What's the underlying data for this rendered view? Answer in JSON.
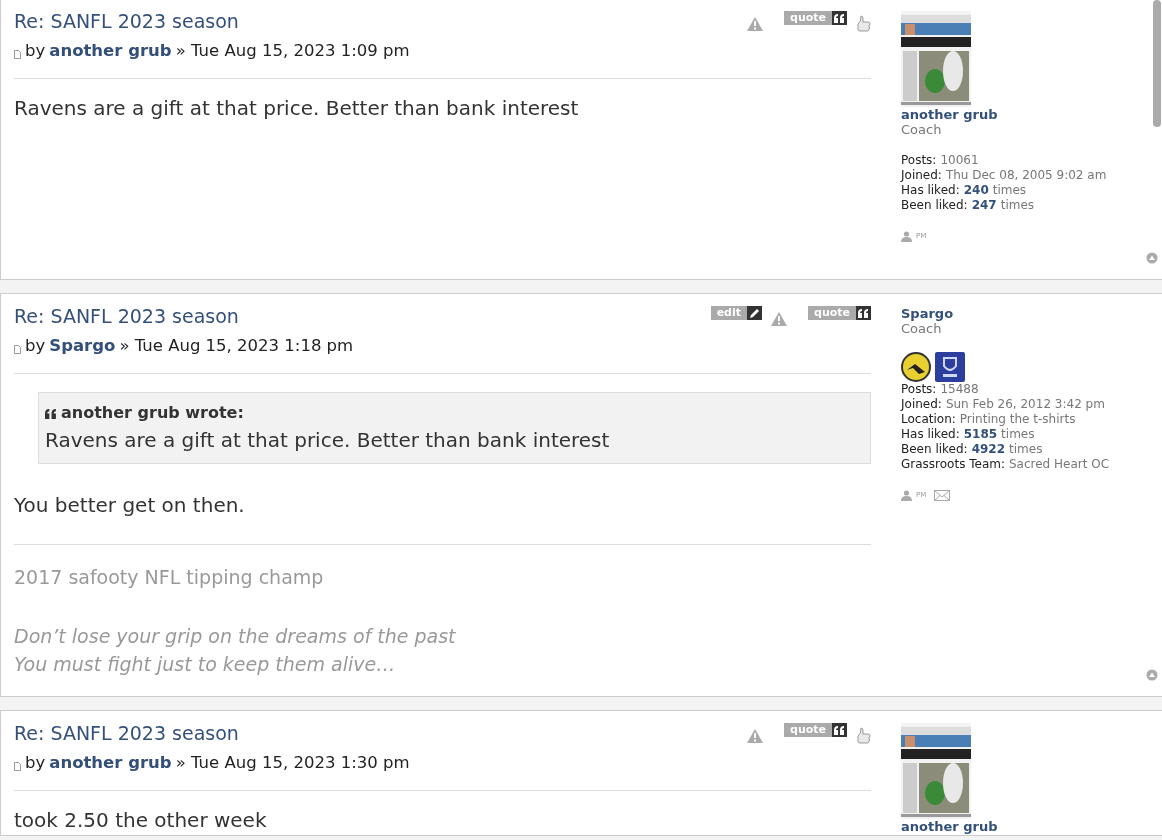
{
  "posts": [
    {
      "title": "Re: SANFL 2023 season",
      "by": "by",
      "author": "another grub",
      "date": "» Tue Aug 15, 2023 1:09 pm",
      "buttons": [
        {
          "kind": "report"
        },
        {
          "kind": "quote",
          "label": "quote"
        },
        {
          "kind": "like"
        }
      ],
      "body": "Ravens are a gift at that price. Better than bank interest",
      "profile": {
        "name": "another grub",
        "rank": "Coach",
        "fields": [
          {
            "label": "Posts:",
            "value": "10061"
          },
          {
            "label": "Joined:",
            "value": "Thu Dec 08, 2005 9:02 am"
          },
          {
            "label": "Has liked:",
            "value": "240",
            "suffix": "times",
            "link": true
          },
          {
            "label": "Been liked:",
            "value": "247",
            "suffix": "times",
            "link": true
          }
        ],
        "contacts": [
          {
            "kind": "pm",
            "label": "PM"
          }
        ]
      }
    },
    {
      "title": "Re: SANFL 2023 season",
      "by": "by",
      "author": "Spargo",
      "date": "» Tue Aug 15, 2023 1:18 pm",
      "buttons": [
        {
          "kind": "edit",
          "label": "edit"
        },
        {
          "kind": "report"
        },
        {
          "kind": "quote",
          "label": "quote"
        }
      ],
      "quote": {
        "author": "another grub wrote:",
        "text": "Ravens are a gift at that price. Better than bank interest"
      },
      "body": "You better get on then.",
      "signature": [
        {
          "kind": "plain",
          "text": "2017 safooty NFL tipping champ"
        },
        {
          "kind": "italic",
          "text": "Don’t lose your grip on the dreams of the past"
        },
        {
          "kind": "italic",
          "text": "You must fight just to keep them alive…"
        }
      ],
      "profile": {
        "name": "Spargo",
        "rank": "Coach",
        "badges": [
          {
            "kind": "tigers"
          },
          {
            "kind": "kangaroos"
          }
        ],
        "fields": [
          {
            "label": "Posts:",
            "value": "15488"
          },
          {
            "label": "Joined:",
            "value": "Sun Feb 26, 2012 3:42 pm"
          },
          {
            "label": "Location:",
            "value": "Printing the t-shirts"
          },
          {
            "label": "Has liked:",
            "value": "5185",
            "suffix": "times",
            "link": true
          },
          {
            "label": "Been liked:",
            "value": "4922",
            "suffix": "times",
            "link": true
          },
          {
            "label": "Grassroots Team:",
            "value": "Sacred Heart OC"
          }
        ],
        "contacts": [
          {
            "kind": "pm",
            "label": "PM"
          },
          {
            "kind": "email"
          }
        ]
      }
    },
    {
      "title": "Re: SANFL 2023 season",
      "by": "by",
      "author": "another grub",
      "date": "» Tue Aug 15, 2023 1:30 pm",
      "buttons": [
        {
          "kind": "report"
        },
        {
          "kind": "quote",
          "label": "quote"
        },
        {
          "kind": "like"
        }
      ],
      "body": "took 2.50 the other week",
      "profile": {
        "name": "another grub"
      }
    }
  ]
}
